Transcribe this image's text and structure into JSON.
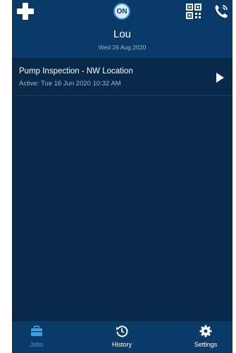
{
  "header": {
    "status_badge": "ON",
    "user_name": "Lou",
    "date": "Wed 26 Aug 2020",
    "icons": [
      "plus-icon",
      "qr-code-icon",
      "phone-icon"
    ]
  },
  "jobs": [
    {
      "title": "Pump Inspection - NW Location",
      "subtitle": "Active: Tue 16 Jun 2020 10:32 AM"
    }
  ],
  "bottom_nav": {
    "items": [
      {
        "label": "Jobs",
        "icon": "briefcase-icon",
        "active": true
      },
      {
        "label": "History",
        "icon": "history-icon",
        "active": false
      },
      {
        "label": "Settings",
        "icon": "gear-icon",
        "active": false
      }
    ]
  },
  "colors": {
    "background": "#08294a",
    "header": "#0a3a68",
    "accent": "#3aa0e0",
    "text_primary": "#ffffff",
    "text_secondary": "#9fb7d1"
  }
}
